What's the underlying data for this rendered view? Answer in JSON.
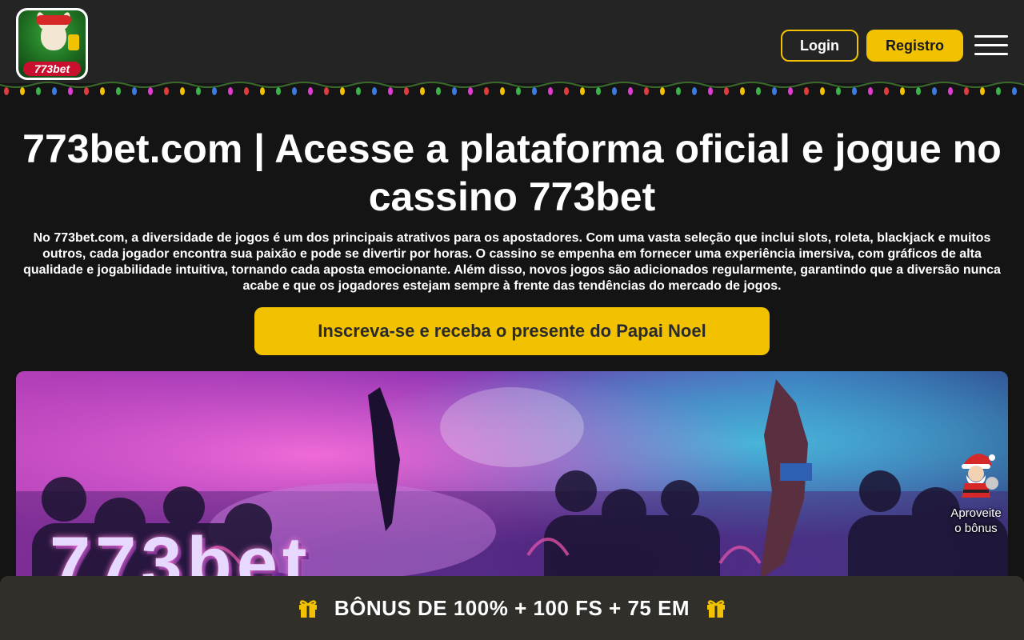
{
  "header": {
    "logo_text": "773bet",
    "login_label": "Login",
    "register_label": "Registro",
    "menu_icon": "hamburger-icon"
  },
  "main": {
    "headline": "773bet.com | Acesse a plataforma oficial e jogue no cassino 773bet",
    "intro": "No 773bet.com, a diversidade de jogos é um dos principais atrativos para os apostadores. Com uma vasta seleção que inclui slots, roleta, blackjack e muitos outros, cada jogador encontra sua paixão e pode se divertir por horas. O cassino se empenha em fornecer uma experiência imersiva, com gráficos de alta qualidade e jogabilidade intuitiva, tornando cada aposta emocionante. Além disso, novos jogos são adicionados regularmente, garantindo que a diversão nunca acabe e que os jogadores estejam sempre à frente das tendências do mercado de jogos.",
    "cta_label": "Inscreva-se e receba o presente do Papai Noel",
    "banner_wordmark": "773bet"
  },
  "santa_widget": {
    "label_line1": "Aproveite",
    "label_line2": "o bônus"
  },
  "bonus_bar": {
    "text": "BÔNUS DE 100% + 100 FS + 75 EM",
    "icon": "gift-icon"
  },
  "colors": {
    "accent": "#f2c200",
    "header_bg": "#242424",
    "page_bg": "#141414",
    "bonus_bar_bg": "#302f2a"
  }
}
